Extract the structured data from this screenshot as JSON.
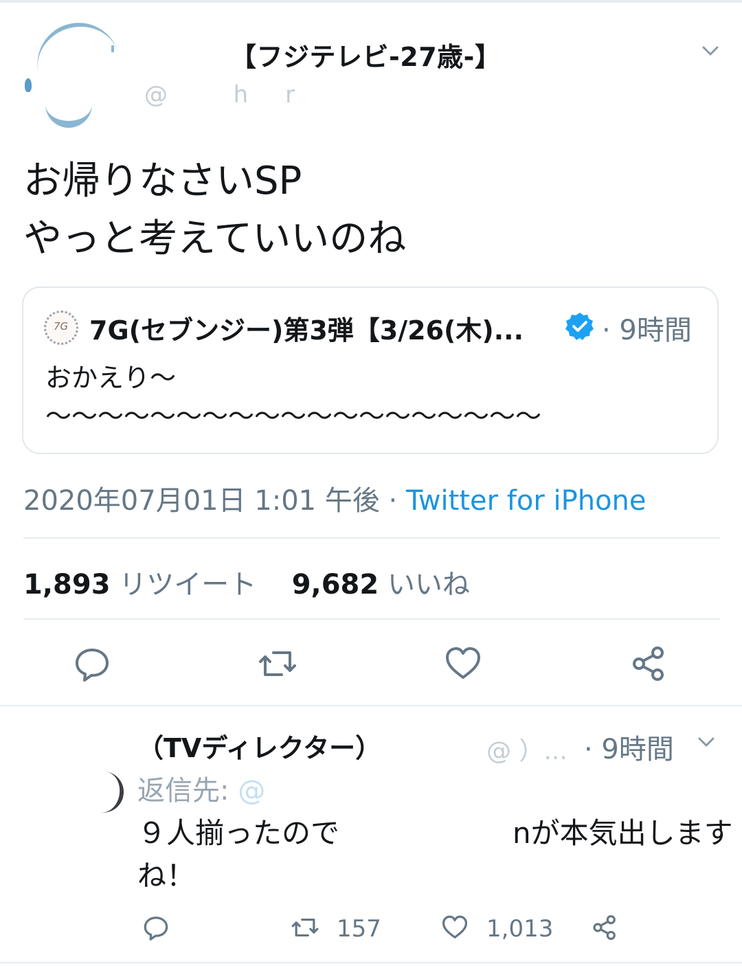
{
  "tweet": {
    "display_name": "【フジテレビ-27歳-】",
    "handle": "@ 　 h　r",
    "text_line1": "お帰りなさいSP",
    "text_line2": "やっと考えていいのね",
    "quoted": {
      "avatar_label": "7G",
      "name": "7G(セブンジー)第3弾【3/26(木)...",
      "time": "· 9時間",
      "text_line1": "おかえり～",
      "text_line2": "～～～～～～～～～～～～～～～～～～～"
    },
    "date": "2020年07月01日 1:01 午後 · ",
    "source": "Twitter for iPhone",
    "stats": {
      "retweet_count": "1,893",
      "retweet_label": "リツイート",
      "like_count": "9,682",
      "like_label": "いいね"
    }
  },
  "reply": {
    "name": "（TVディレクター）",
    "handle": "@ ）...",
    "time": "· 9時間",
    "reply_to_label": "返信先: ",
    "reply_to_handle": "@",
    "text_line1": "９人揃ったので　　　　　　nが本気出します",
    "text_line2": "ね！",
    "retweet_count": "157",
    "like_count": "1,013"
  },
  "colors": {
    "link": "#1b95e0",
    "muted": "#657786",
    "verified": "#1da1f2",
    "border": "#e1e8ed"
  },
  "icons": [
    "chevron-down-icon",
    "verified-badge-icon",
    "reply-icon",
    "retweet-icon",
    "like-icon",
    "share-icon"
  ]
}
